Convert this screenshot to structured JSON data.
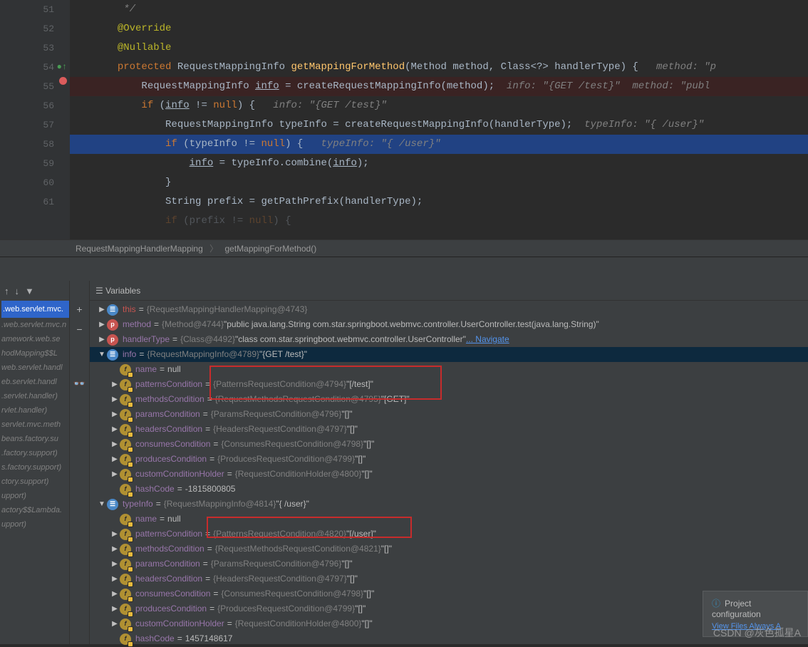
{
  "editor": {
    "lines": [
      {
        "num": "51",
        "html": "        <span class='comment'>*/</span>"
      },
      {
        "num": "52",
        "html": "       <span class='ann'>@Override</span>"
      },
      {
        "num": "53",
        "html": "       <span class='ann'>@Nullable</span>"
      },
      {
        "num": "54",
        "html": "       <span class='kw'>protected</span> <span class='type'>RequestMappingInfo</span> <span class='method'>getMappingForMethod</span>(<span class='type'>Method</span> method, <span class='type'>Class</span>&lt;?&gt; handlerType) {   <span class='comment'>method: \"p</span>",
        "icon": "green-up"
      },
      {
        "num": "55",
        "html": "           <span class='type'>RequestMappingInfo</span> <span class='underline'>info</span> = createRequestMappingInfo(method);  <span class='comment'>info: \"{GET /test}\"  method: \"publ</span>",
        "cls": "hl-bp",
        "icon": "bp"
      },
      {
        "num": "56",
        "html": "           <span class='kw'>if</span> (<span class='underline'>info</span> != <span class='kw'>null</span>) {   <span class='comment'>info: \"{GET /test}\"</span>"
      },
      {
        "num": "57",
        "html": "               <span class='type'>RequestMappingInfo</span> typeInfo = createRequestMappingInfo(handlerType);  <span class='comment'>typeInfo: \"{ /user}\" </span>"
      },
      {
        "num": "58",
        "html": "               <span class='kw'>if</span> (typeInfo != <span class='kw'>null</span>) {   <span class='comment'>typeInfo: \"{ /user}\"</span>",
        "cls": "hl-exec"
      },
      {
        "num": "59",
        "html": "                   <span class='underline'>info</span> = typeInfo.combine(<span class='underline'>info</span>);"
      },
      {
        "num": "60",
        "html": "               }"
      },
      {
        "num": "61",
        "html": "               <span class='type'>String</span> prefix = getPathPrefix(handlerType);"
      },
      {
        "num": "",
        "html": "               <span class='kw'>if</span> (prefix != <span class='kw'>null</span>) {",
        "fade": true
      }
    ]
  },
  "breadcrumb": {
    "a": "RequestMappingHandlerMapping",
    "b": "getMappingForMethod()"
  },
  "frames": {
    "active": ".web.servlet.mvc.",
    "list": [
      ".web.servlet.mvc.n",
      "amework.web.se",
      "hodMapping$$L",
      "",
      "",
      "web.servlet.handl",
      "eb.servlet.handl",
      ".servlet.handler)",
      "rvlet.handler)",
      "servlet.mvc.meth",
      "beans.factory.su",
      ".factory.support)",
      "s.factory.support)",
      "ctory.support)",
      "upport)",
      "actory$$Lambda.",
      "upport)"
    ]
  },
  "varsHeader": "Variables",
  "vars": [
    {
      "lvl": 0,
      "arrow": "right",
      "icon": "obj",
      "iconText": "☰",
      "name": "this",
      "nameCls": "link",
      "eq": "=",
      "type": "{RequestMappingHandlerMapping@4743}",
      "val": ""
    },
    {
      "lvl": 0,
      "arrow": "right",
      "icon": "p",
      "iconText": "p",
      "name": "method",
      "eq": "=",
      "type": "{Method@4744}",
      "val": " \"public java.lang.String com.star.springboot.webmvc.controller.UserController.test(java.lang.String)\""
    },
    {
      "lvl": 0,
      "arrow": "right",
      "icon": "p",
      "iconText": "p",
      "name": "handlerType",
      "eq": "=",
      "type": "{Class@4492}",
      "val": " \"class com.star.springboot.webmvc.controller.UserController\"",
      "extra": "Navigate"
    },
    {
      "lvl": 0,
      "arrow": "down",
      "icon": "obj",
      "iconText": "☰",
      "name": "info",
      "eq": "=",
      "type": "{RequestMappingInfo@4789}",
      "val": " \"{GET /test}\"",
      "selected": true
    },
    {
      "lvl": 1,
      "arrow": "none",
      "icon": "f",
      "name": "name",
      "eq": "=",
      "val": " null"
    },
    {
      "lvl": 1,
      "arrow": "right",
      "icon": "f",
      "name": "patternsCondition",
      "eq": "=",
      "type": "{PatternsRequestCondition@4794}",
      "val": " \"[/test]\""
    },
    {
      "lvl": 1,
      "arrow": "right",
      "icon": "f",
      "name": "methodsCondition",
      "eq": "=",
      "type": "{RequestMethodsRequestCondition@4795}",
      "val": " \"[GET]\""
    },
    {
      "lvl": 1,
      "arrow": "right",
      "icon": "f",
      "name": "paramsCondition",
      "eq": "=",
      "type": "{ParamsRequestCondition@4796}",
      "val": " \"[]\""
    },
    {
      "lvl": 1,
      "arrow": "right",
      "icon": "f",
      "name": "headersCondition",
      "eq": "=",
      "type": "{HeadersRequestCondition@4797}",
      "val": " \"[]\""
    },
    {
      "lvl": 1,
      "arrow": "right",
      "icon": "f",
      "name": "consumesCondition",
      "eq": "=",
      "type": "{ConsumesRequestCondition@4798}",
      "val": " \"[]\""
    },
    {
      "lvl": 1,
      "arrow": "right",
      "icon": "f",
      "name": "producesCondition",
      "eq": "=",
      "type": "{ProducesRequestCondition@4799}",
      "val": " \"[]\""
    },
    {
      "lvl": 1,
      "arrow": "right",
      "icon": "f",
      "name": "customConditionHolder",
      "eq": "=",
      "type": "{RequestConditionHolder@4800}",
      "val": " \"[]\""
    },
    {
      "lvl": 1,
      "arrow": "none",
      "icon": "f",
      "name": "hashCode",
      "eq": "=",
      "val": " -1815800805"
    },
    {
      "lvl": 0,
      "arrow": "down",
      "icon": "obj",
      "iconText": "☰",
      "name": "typeInfo",
      "eq": "=",
      "type": "{RequestMappingInfo@4814}",
      "val": " \"{ /user}\""
    },
    {
      "lvl": 1,
      "arrow": "none",
      "icon": "f",
      "name": "name",
      "eq": "=",
      "val": " null"
    },
    {
      "lvl": 1,
      "arrow": "right",
      "icon": "f",
      "name": "patternsCondition",
      "eq": "=",
      "type": "{PatternsRequestCondition@4820}",
      "val": " \"[/user]\""
    },
    {
      "lvl": 1,
      "arrow": "right",
      "icon": "f",
      "name": "methodsCondition",
      "eq": "=",
      "type": "{RequestMethodsRequestCondition@4821}",
      "val": " \"[]\""
    },
    {
      "lvl": 1,
      "arrow": "right",
      "icon": "f",
      "name": "paramsCondition",
      "eq": "=",
      "type": "{ParamsRequestCondition@4796}",
      "val": " \"[]\""
    },
    {
      "lvl": 1,
      "arrow": "right",
      "icon": "f",
      "name": "headersCondition",
      "eq": "=",
      "type": "{HeadersRequestCondition@4797}",
      "val": " \"[]\""
    },
    {
      "lvl": 1,
      "arrow": "right",
      "icon": "f",
      "name": "consumesCondition",
      "eq": "=",
      "type": "{ConsumesRequestCondition@4798}",
      "val": " \"[]\""
    },
    {
      "lvl": 1,
      "arrow": "right",
      "icon": "f",
      "name": "producesCondition",
      "eq": "=",
      "type": "{ProducesRequestCondition@4799}",
      "val": " \"[]\""
    },
    {
      "lvl": 1,
      "arrow": "right",
      "icon": "f",
      "name": "customConditionHolder",
      "eq": "=",
      "type": "{RequestConditionHolder@4800}",
      "val": " \"[]\""
    },
    {
      "lvl": 1,
      "arrow": "none",
      "icon": "f",
      "name": "hashCode",
      "eq": "=",
      "val": " 1457148617"
    }
  ],
  "notif": {
    "title": "Project configuration",
    "links": "View Files   Always A"
  },
  "watermark": "CSDN @灰色孤星A"
}
